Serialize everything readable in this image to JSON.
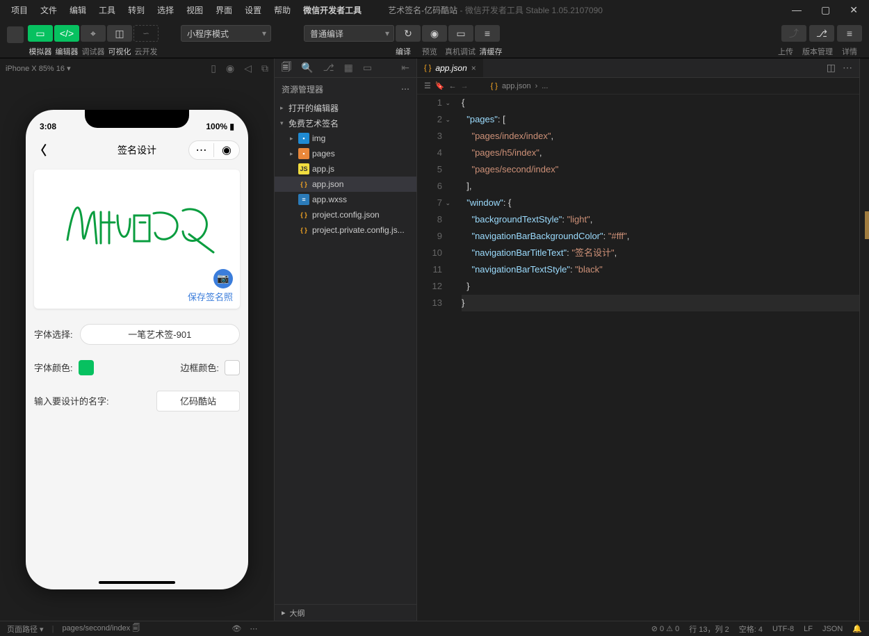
{
  "menu": {
    "items": [
      "项目",
      "文件",
      "编辑",
      "工具",
      "转到",
      "选择",
      "视图",
      "界面",
      "设置",
      "帮助",
      "微信开发者工具"
    ]
  },
  "window": {
    "title": "艺术签名-亿码酷站",
    "suffix": " - 微信开发者工具 Stable 1.05.2107090"
  },
  "toolbar": {
    "labels": {
      "simulator": "模拟器",
      "editor": "编辑器",
      "debugger": "调试器",
      "visualizer": "可视化",
      "cloud": "云开发"
    },
    "mode": "小程序模式",
    "compile_mode": "普通编译",
    "actions": {
      "compile": "编译",
      "preview": "预览",
      "remote": "真机调试",
      "clear": "清缓存",
      "upload": "上传",
      "version": "版本管理",
      "detail": "详情"
    }
  },
  "simbar": {
    "device": "iPhone X 85% 16"
  },
  "phone": {
    "time": "3:08",
    "battery": "100%",
    "page_title": "签名设计",
    "save_link": "保存签名照",
    "font_label": "字体选择:",
    "font_value": "一笔艺术签-901",
    "color_label": "字体颜色:",
    "border_label": "边框颜色:",
    "name_label": "输入要设计的名字:",
    "name_value": "亿码酷站"
  },
  "explorer": {
    "title": "资源管理器",
    "section": "打开的编辑器",
    "project": "免费艺术签名",
    "items": [
      {
        "name": "img",
        "type": "folder",
        "indent": 2
      },
      {
        "name": "pages",
        "type": "folder",
        "indent": 2
      },
      {
        "name": "app.js",
        "type": "js",
        "indent": 2
      },
      {
        "name": "app.json",
        "type": "json",
        "indent": 2,
        "selected": true
      },
      {
        "name": "app.wxss",
        "type": "wxss",
        "indent": 2
      },
      {
        "name": "project.config.json",
        "type": "json",
        "indent": 2
      },
      {
        "name": "project.private.config.js...",
        "type": "json",
        "indent": 2
      }
    ],
    "outline": "大纲"
  },
  "editor": {
    "tab": "app.json",
    "crumb": "app.json",
    "crumb_more": "...",
    "json": {
      "pages": [
        "pages/index/index",
        "pages/h5/index",
        "pages/second/index"
      ],
      "window": {
        "backgroundTextStyle": "light",
        "navigationBarBackgroundColor": "#fff",
        "navigationBarTitleText": "签名设计",
        "navigationBarTextStyle": "black"
      }
    }
  },
  "status": {
    "path_label": "页面路径",
    "path": "pages/second/index",
    "errors": "0",
    "warnings": "0",
    "cursor": "行 13，列 2",
    "spaces": "空格: 4",
    "encoding": "UTF-8",
    "eol": "LF",
    "lang": "JSON"
  }
}
